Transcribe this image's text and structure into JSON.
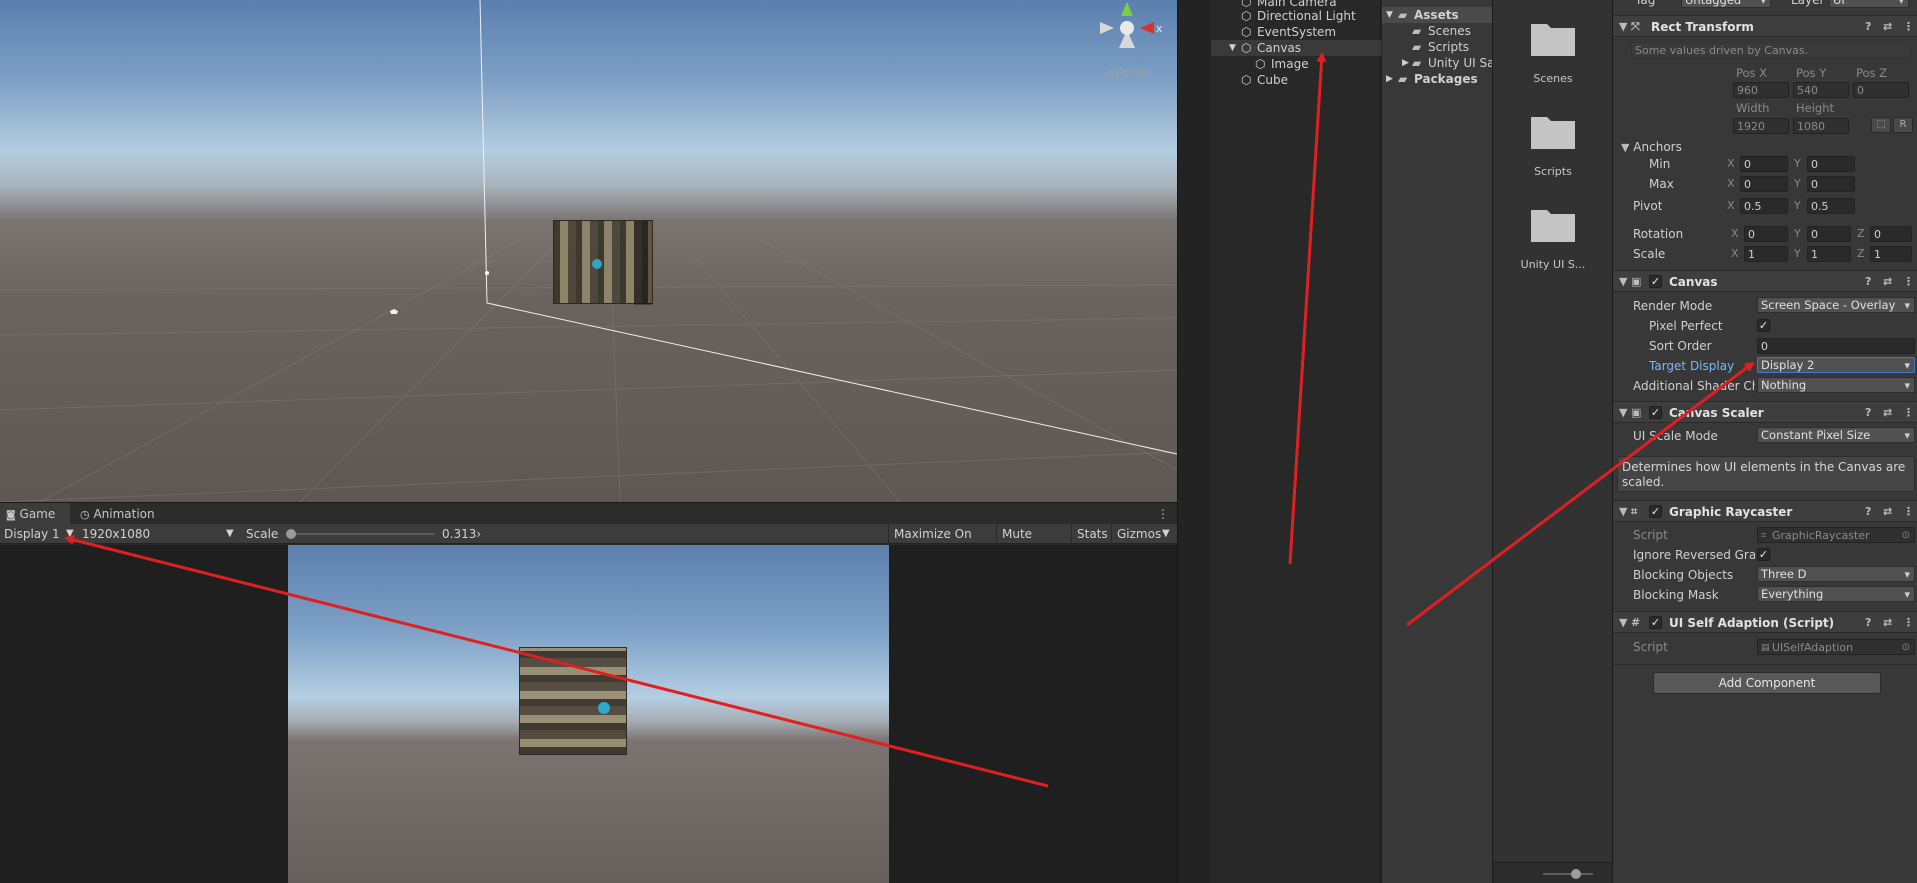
{
  "scene": {
    "persp_label": "<Persp",
    "gizmo_axes": {
      "x": "x"
    }
  },
  "game_tabs": [
    {
      "label": "Game"
    },
    {
      "label": "Animation"
    }
  ],
  "game_toolbar": {
    "display": "Display 1",
    "resolution": "1920x1080",
    "scale_label": "Scale",
    "scale_value": "0.313›",
    "scale_fraction": 0.0,
    "buttons": [
      "Maximize On Play",
      "Mute Audio",
      "Stats",
      "Gizmos"
    ]
  },
  "hierarchy": {
    "items": [
      {
        "label": "Main Camera"
      },
      {
        "label": "Directional Light"
      },
      {
        "label": "EventSystem"
      },
      {
        "label": "Canvas"
      },
      {
        "label": "Image"
      },
      {
        "label": "Cube"
      }
    ]
  },
  "project": {
    "tree": [
      {
        "label": "Assets"
      },
      {
        "label": "Scenes"
      },
      {
        "label": "Scripts"
      },
      {
        "label": "Unity UI Sa"
      },
      {
        "label": "Packages"
      }
    ],
    "grid": [
      {
        "label": "Scenes"
      },
      {
        "label": "Scripts"
      },
      {
        "label": "Unity UI S..."
      }
    ]
  },
  "inspector": {
    "top": {
      "tag_label": "Tag",
      "tag_value": "Untagged",
      "layer_label": "Layer",
      "layer_value": "UI"
    },
    "rect_transform": {
      "title": "Rect Transform",
      "driven_note": "Some values driven by Canvas.",
      "pos_headers": [
        "Pos X",
        "Pos Y",
        "Pos Z"
      ],
      "pos_values": [
        "960",
        "540",
        "0"
      ],
      "size_headers": [
        "Width",
        "Height"
      ],
      "size_values": [
        "1920",
        "1080"
      ],
      "anchors_label": "Anchors",
      "min_label": "Min",
      "min_x": "0",
      "min_y": "0",
      "max_label": "Max",
      "max_x": "0",
      "max_y": "0",
      "pivot_label": "Pivot",
      "pivot_x": "0.5",
      "pivot_y": "0.5",
      "rotation_label": "Rotation",
      "rotation": [
        "0",
        "0",
        "0"
      ],
      "scale_label": "Scale",
      "scale": [
        "1",
        "1",
        "1"
      ],
      "r_button": "R"
    },
    "canvas": {
      "title": "Canvas",
      "render_mode_label": "Render Mode",
      "render_mode": "Screen Space - Overlay",
      "pixel_perfect_label": "Pixel Perfect",
      "sort_order_label": "Sort Order",
      "sort_order": "0",
      "target_display_label": "Target Display",
      "target_display": "Display 2",
      "shader_label": "Additional Shader Ch",
      "shader_value": "Nothing"
    },
    "canvas_scaler": {
      "title": "Canvas Scaler",
      "mode_label": "UI Scale Mode",
      "mode_value": "Constant Pixel Size",
      "help": "Determines how UI elements in the Canvas are scaled."
    },
    "graphic_raycaster": {
      "title": "Graphic Raycaster",
      "script_label": "Script",
      "script_value": "GraphicRaycaster",
      "ignore_label": "Ignore Reversed Grap",
      "blocking_objects_label": "Blocking Objects",
      "blocking_objects": "Three D",
      "blocking_mask_label": "Blocking Mask",
      "blocking_mask": "Everything"
    },
    "ui_self_adaption": {
      "title": "UI Self Adaption (Script)",
      "script_label": "Script",
      "script_value": "UISelfAdaption"
    },
    "add_component": "Add Component"
  },
  "colors": {
    "annotation_arrow": "#e02020",
    "selection_blue": "#3d7bd0",
    "label_blue": "#7bb7ff"
  }
}
